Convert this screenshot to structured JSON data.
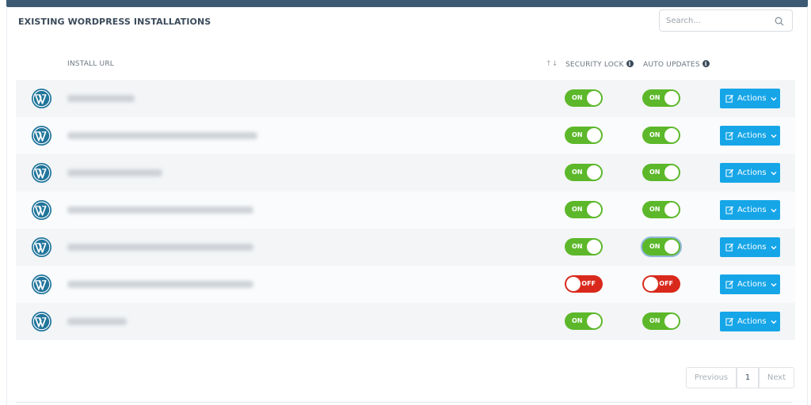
{
  "panel": {
    "title": "EXISTING WORDPRESS INSTALLATIONS"
  },
  "search": {
    "placeholder": "Search..."
  },
  "table": {
    "headers": {
      "install_url": "INSTALL URL",
      "sort_icon": "↑↓",
      "security_lock": "SECURITY LOCK",
      "auto_updates": "AUTO UPDATES",
      "info_glyph": "i"
    },
    "rows": [
      {
        "security_lock": "ON",
        "auto_updates": "ON",
        "action": "Actions"
      },
      {
        "security_lock": "ON",
        "auto_updates": "ON",
        "action": "Actions"
      },
      {
        "security_lock": "ON",
        "auto_updates": "ON",
        "action": "Actions"
      },
      {
        "security_lock": "ON",
        "auto_updates": "ON",
        "action": "Actions"
      },
      {
        "security_lock": "ON",
        "auto_updates": "ON",
        "action": "Actions"
      },
      {
        "security_lock": "OFF",
        "auto_updates": "OFF",
        "action": "Actions"
      },
      {
        "security_lock": "ON",
        "auto_updates": "ON",
        "action": "Actions"
      }
    ]
  },
  "pagination": {
    "previous": "Previous",
    "page": "1",
    "next": "Next"
  },
  "icons": {
    "row_icon": "wordpress-logo-icon",
    "search": "search-icon",
    "edit": "edit-icon",
    "chevron": "chevron-down-icon",
    "info": "info-icon"
  },
  "colors": {
    "top_bar": "#3c5a73",
    "toggle_on": "#5cb82a",
    "toggle_off": "#d9291c",
    "actions_button": "#16a6e8",
    "wordpress_logo": "#21759b"
  }
}
